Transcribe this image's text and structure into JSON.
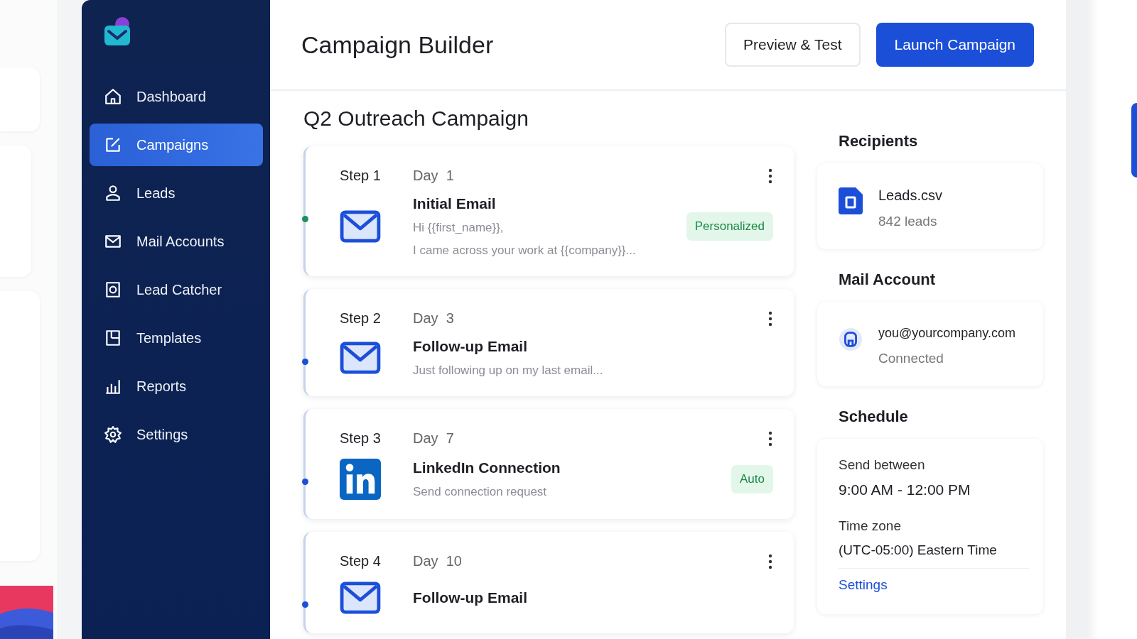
{
  "sidebar": {
    "items": [
      {
        "label": "Dashboard",
        "kind": "home",
        "selected": false
      },
      {
        "label": "Campaigns",
        "kind": "edit",
        "selected": true
      },
      {
        "label": "Leads",
        "kind": "person",
        "selected": false
      },
      {
        "label": "Mail Accounts",
        "kind": "mail",
        "selected": false
      },
      {
        "label": "Lead Catcher",
        "kind": "target",
        "selected": false
      },
      {
        "label": "Templates",
        "kind": "doc",
        "selected": false
      },
      {
        "label": "Reports",
        "kind": "chart",
        "selected": false
      },
      {
        "label": "Settings",
        "kind": "gear",
        "selected": false
      }
    ]
  },
  "header": {
    "title": "Campaign Builder",
    "buttons": [
      {
        "label": "Preview & Test",
        "kind": "secondary"
      },
      {
        "label": "Launch Campaign",
        "kind": "primary"
      }
    ]
  },
  "campaign": {
    "title": "Q2 Outreach Campaign",
    "steps": [
      {
        "step": "Step 1",
        "day": "Day  1",
        "kind": "email",
        "title": "Initial Email",
        "color": "#1e8e5a",
        "lines": [
          "Hi {{first_name}},",
          "I came across your work at {{company}}..."
        ],
        "badge": "Personalized"
      },
      {
        "step": "Step 2",
        "day": "Day  3",
        "kind": "email",
        "title": "Follow-up Email",
        "color": "#1c4fd8",
        "lines": [
          "Just following up on my last email..."
        ]
      },
      {
        "step": "Step 3",
        "day": "Day  7",
        "kind": "linkedin",
        "title": "LinkedIn Connection",
        "color": "#1c4fd8",
        "lines": [
          "Send connection request"
        ],
        "badge": "Auto"
      },
      {
        "step": "Step 4",
        "day": "Day  10",
        "kind": "email",
        "title": "Follow-up Email",
        "color": "#1c4fd8"
      }
    ]
  },
  "recipients": {
    "title": "Recipients",
    "file": "Leads.csv",
    "count": "842 leads"
  },
  "mail_account": {
    "title": "Mail Account",
    "email": "you@yourcompany.com",
    "status": "Connected"
  },
  "schedule": {
    "title": "Schedule",
    "send_label": "Send between",
    "send_value": "9:00 AM - 12:00 PM",
    "tz_label": "Time zone",
    "tz_value": "(UTC-05:00) Eastern Time",
    "link": "Settings"
  }
}
